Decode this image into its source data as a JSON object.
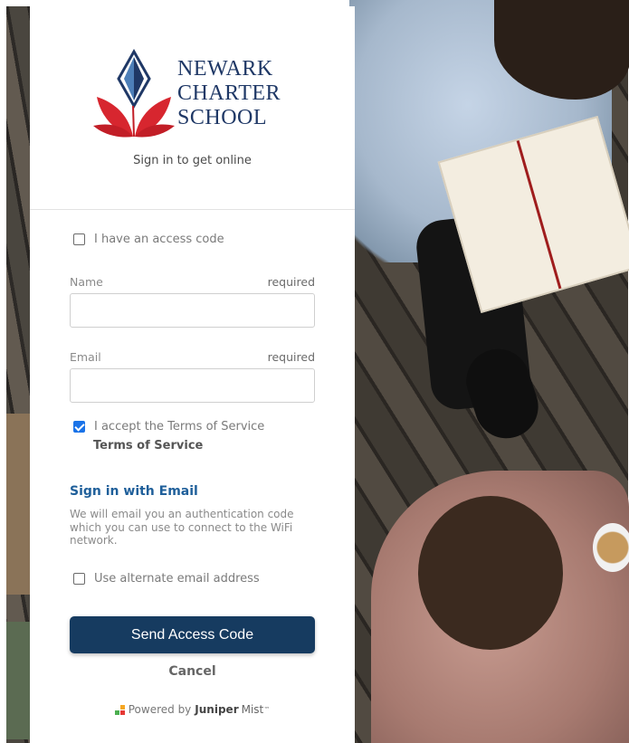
{
  "logo": {
    "line1": "NEWARK",
    "line2": "CHARTER",
    "line3": "SCHOOL"
  },
  "subtitle": "Sign in to get online",
  "access_code": {
    "label": "I have an access code",
    "checked": false
  },
  "name_field": {
    "label": "Name",
    "required": "required",
    "value": ""
  },
  "email_field": {
    "label": "Email",
    "required": "required",
    "value": ""
  },
  "terms": {
    "label": "I accept the Terms of Service",
    "link": "Terms of Service",
    "checked": true
  },
  "email_signin": {
    "heading": "Sign in with Email",
    "description": "We will email you an authentication code which you can use to connect to the WiFi network."
  },
  "alternate_email": {
    "label": "Use alternate email address",
    "checked": false
  },
  "buttons": {
    "send": "Send Access Code",
    "cancel": "Cancel"
  },
  "footer": {
    "powered_by": "Powered by",
    "brand": "Juniper",
    "product": "Mist",
    "tm": "™"
  },
  "colors": {
    "primary_button": "#163b60",
    "link_blue": "#1f5f9a",
    "logo_navy": "#1f3866",
    "logo_red": "#d7262f",
    "checkbox_checked": "#1a73e8"
  },
  "icons": {
    "logo": "newark-charter-logo-icon",
    "footer": "juniper-mist-icon"
  }
}
